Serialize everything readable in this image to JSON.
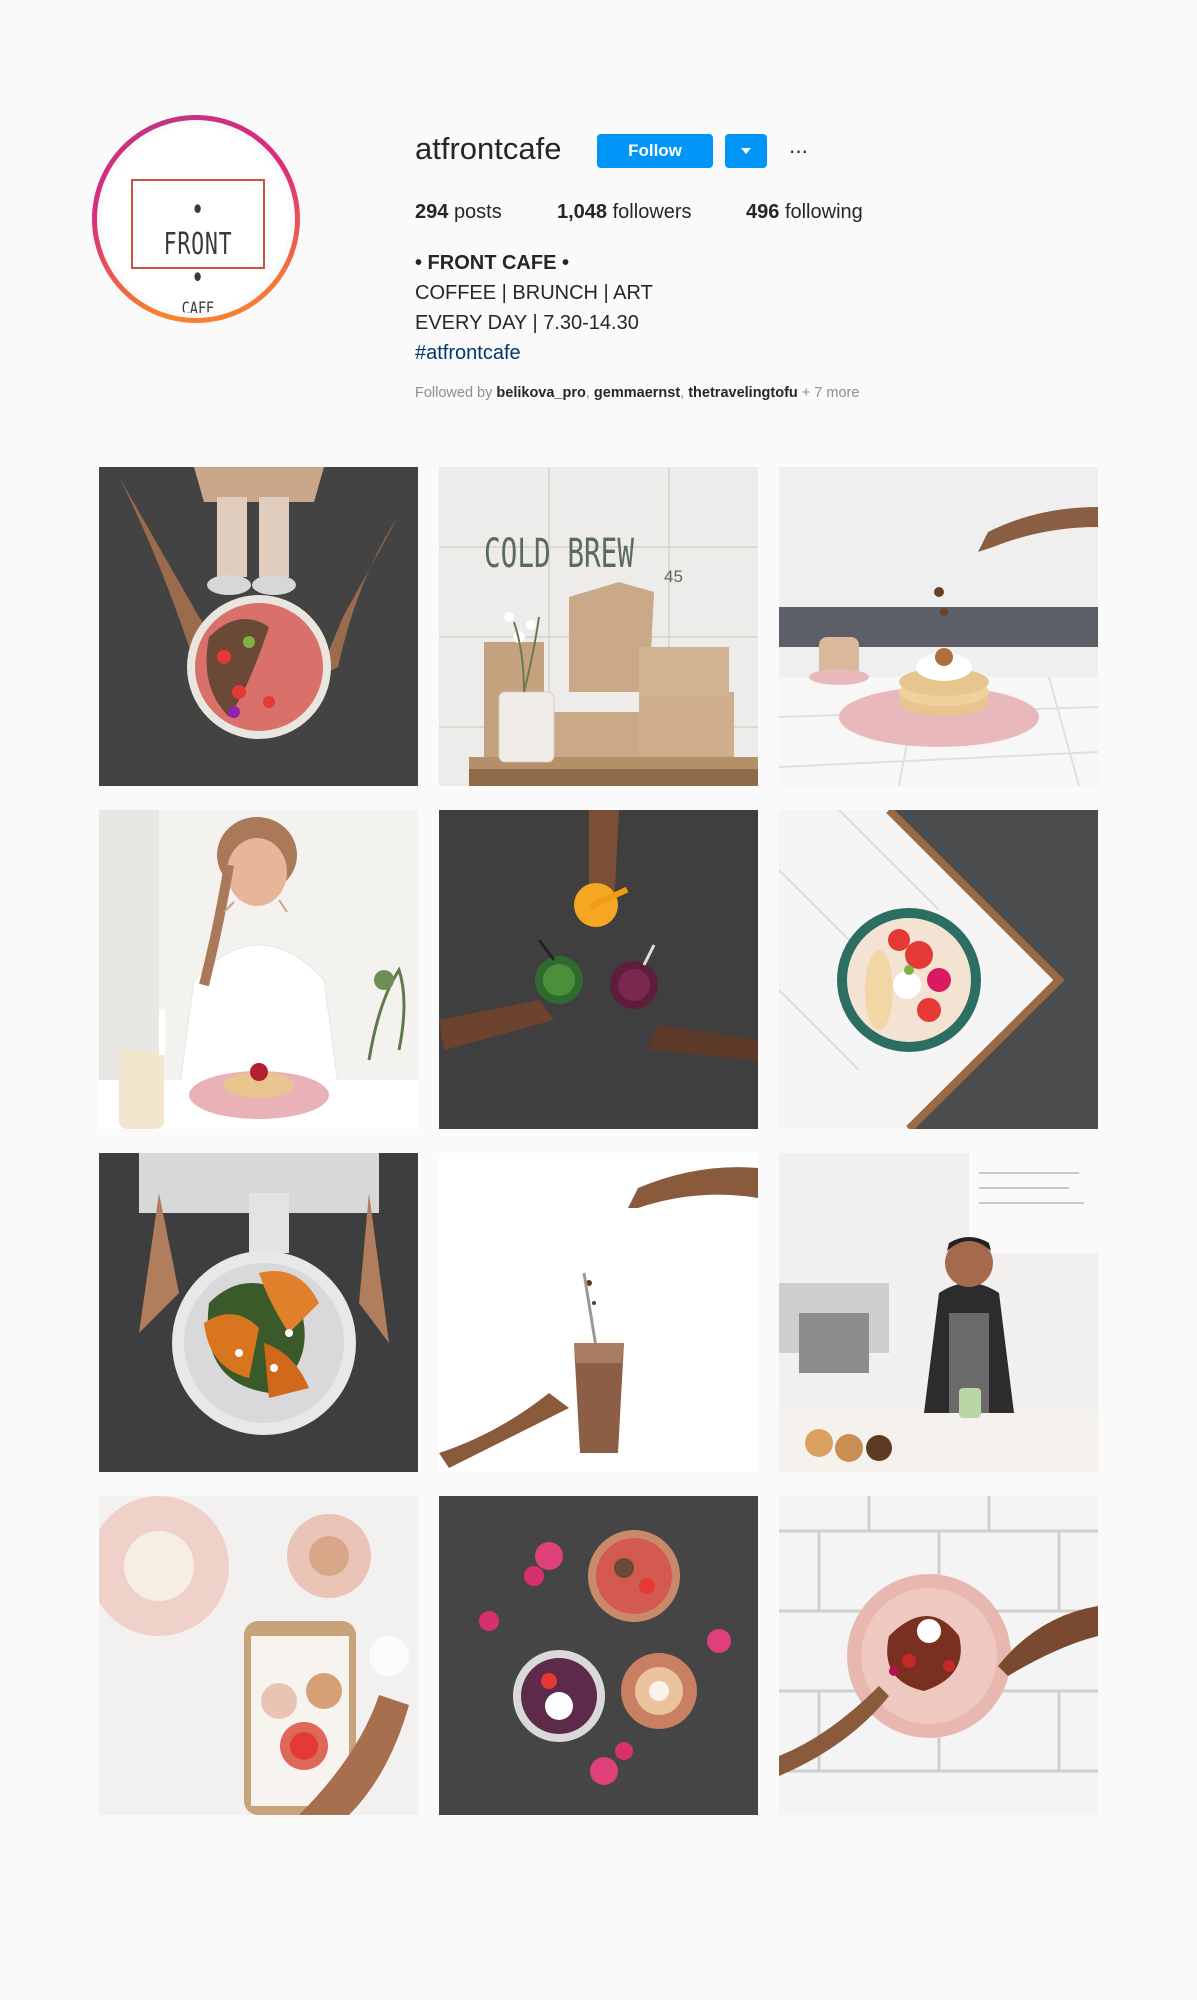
{
  "profile": {
    "username": "atfrontcafe",
    "logo_top": "• FRONT •",
    "logo_bottom": "CAFE",
    "follow_label": "Follow",
    "more_glyph": "···",
    "ring_colors": [
      "#f58529",
      "#dd2a7b",
      "#c13584"
    ],
    "button_color": "#0095f6"
  },
  "stats": {
    "posts_count": "294",
    "posts_label": "posts",
    "followers_count": "1,048",
    "followers_label": "followers",
    "following_count": "496",
    "following_label": "following"
  },
  "bio": {
    "name": "• FRONT CAFE •",
    "line1": "COFFEE | BRUNCH | ART",
    "line2": "EVERY DAY | 7.30-14.30",
    "hashtag": "#atfrontcafe"
  },
  "followed_by": {
    "prefix": "Followed by",
    "users": [
      "belikova_pro",
      "gemmaernst",
      "thetravelingtofu"
    ],
    "separator": ",",
    "more": "+ 7 more"
  },
  "posts": [
    {
      "icon": "smoothie-bowl-photo"
    },
    {
      "icon": "cold-brew-bags-photo",
      "sign_text": "COLD BREW",
      "sign_number": "45"
    },
    {
      "icon": "pancakes-photo"
    },
    {
      "icon": "woman-eating-pancakes-photo"
    },
    {
      "icon": "smoothie-cheers-photo"
    },
    {
      "icon": "fruit-bowl-photo"
    },
    {
      "icon": "pumpkin-salad-photo"
    },
    {
      "icon": "chocolate-smoothie-photo"
    },
    {
      "icon": "barista-photo"
    },
    {
      "icon": "phone-photo-of-food"
    },
    {
      "icon": "flatlay-bowls-flowers-photo"
    },
    {
      "icon": "pink-plate-dessert-photo"
    }
  ]
}
